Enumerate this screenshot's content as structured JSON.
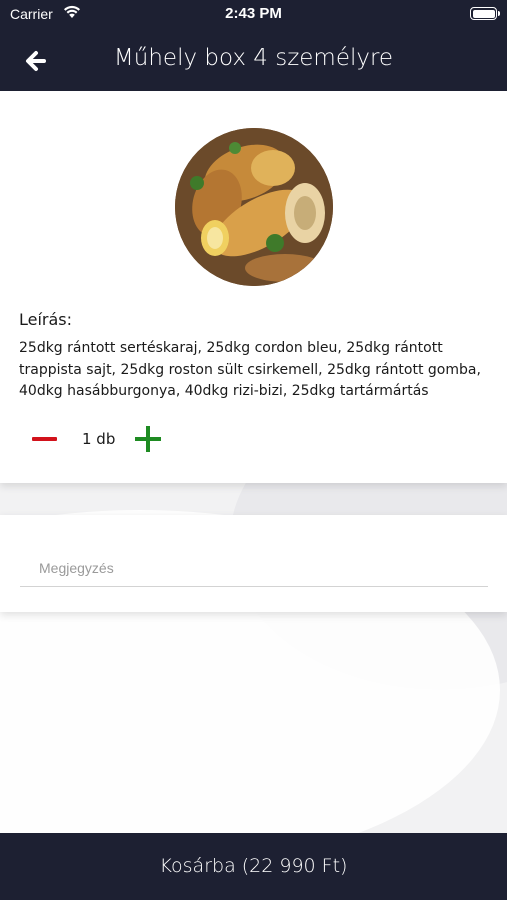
{
  "status_bar": {
    "carrier": "Carrier",
    "time": "2:43 PM"
  },
  "header": {
    "title": "Műhely box 4 személyre",
    "back_icon": "arrow-left-icon"
  },
  "product": {
    "image_icon": "food-photo",
    "description_label": "Leírás:",
    "description": "25dkg rántott sertéskaraj, 25dkg cordon bleu, 25dkg rántott trappista sajt, 25dkg roston sült csirkemell, 25dkg rántott gomba, 40dkg hasábburgonya, 40dkg rizi-bizi, 25dkg tartármártás",
    "quantity": "1 db"
  },
  "note": {
    "placeholder": "Megjegyzés",
    "value": ""
  },
  "cart_button": {
    "label": "Kosárba (22 990 Ft)"
  },
  "colors": {
    "bar": "#1d2032",
    "minus": "#d2121b",
    "plus": "#1e8b22"
  }
}
